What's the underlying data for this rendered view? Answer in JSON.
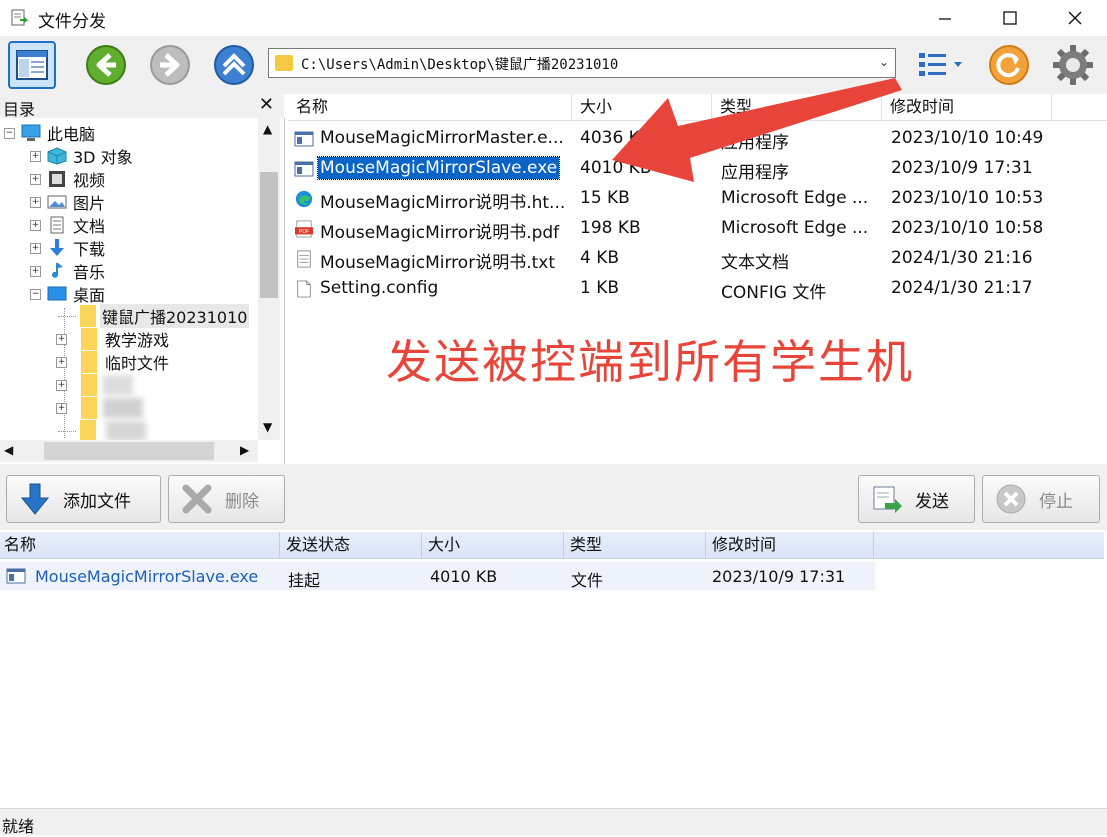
{
  "window": {
    "title": "文件分发",
    "controls": [
      "minimize-icon",
      "maximize-icon",
      "close-icon"
    ]
  },
  "toolbar": {
    "address": "C:\\Users\\Admin\\Desktop\\键鼠广播20231010",
    "buttons": [
      "panel-toggle-icon",
      "back-icon",
      "forward-icon",
      "up-icon",
      "view-list-icon",
      "refresh-icon",
      "settings-icon"
    ]
  },
  "tree": {
    "title": "目录",
    "close": "✕",
    "items": [
      {
        "label": "此电脑",
        "icon": "computer-icon"
      },
      {
        "label": "3D 对象",
        "icon": "3d-objects-icon"
      },
      {
        "label": "视频",
        "icon": "video-icon"
      },
      {
        "label": "图片",
        "icon": "picture-icon"
      },
      {
        "label": "文档",
        "icon": "document-icon"
      },
      {
        "label": "下载",
        "icon": "download-icon"
      },
      {
        "label": "音乐",
        "icon": "music-icon"
      },
      {
        "label": "桌面",
        "icon": "desktop-icon"
      },
      {
        "label": "键鼠广播20231010",
        "icon": "folder-icon",
        "selected": true
      },
      {
        "label": "教学游戏",
        "icon": "folder-icon"
      },
      {
        "label": "临时文件",
        "icon": "folder-icon"
      }
    ]
  },
  "files": {
    "columns": [
      "名称",
      "大小",
      "类型",
      "修改时间"
    ],
    "rows": [
      {
        "name": "MouseMagicMirrorMaster.e...",
        "size": "4036 KB",
        "type": "应用程序",
        "modified": "2023/10/10 10:49",
        "icon": "exe-icon"
      },
      {
        "name": "MouseMagicMirrorSlave.exe",
        "size": "4010 KB",
        "type": "应用程序",
        "modified": "2023/10/9 17:31",
        "icon": "exe-icon",
        "selected": true
      },
      {
        "name": "MouseMagicMirror说明书.ht...",
        "size": "15 KB",
        "type": "Microsoft Edge ...",
        "modified": "2023/10/10 10:53",
        "icon": "edge-icon"
      },
      {
        "name": "MouseMagicMirror说明书.pdf",
        "size": "198 KB",
        "type": "Microsoft Edge ...",
        "modified": "2023/10/10 10:58",
        "icon": "pdf-icon"
      },
      {
        "name": "MouseMagicMirror说明书.txt",
        "size": "4 KB",
        "type": "文本文档",
        "modified": "2024/1/30 21:16",
        "icon": "text-file-icon"
      },
      {
        "name": "Setting.config",
        "size": "1 KB",
        "type": "CONFIG 文件",
        "modified": "2024/1/30 21:17",
        "icon": "file-icon"
      }
    ]
  },
  "annotation": "发送被控端到所有学生机",
  "actions": {
    "add_file": "添加文件",
    "delete": "删除",
    "send": "发送",
    "stop": "停止"
  },
  "send_list": {
    "columns": [
      "名称",
      "发送状态",
      "大小",
      "类型",
      "修改时间"
    ],
    "rows": [
      {
        "name": "MouseMagicMirrorSlave.exe",
        "status": "挂起",
        "size": "4010 KB",
        "type": "文件",
        "modified": "2023/10/9 17:31"
      }
    ]
  },
  "status": "就绪",
  "colors": {
    "accent": "#0078d7",
    "annotation": "#e8453a",
    "selection": "#0a64c8"
  }
}
